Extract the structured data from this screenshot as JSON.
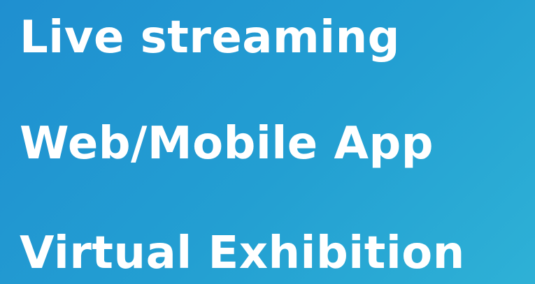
{
  "banner": {
    "background_colors": [
      "#1f8fd0",
      "#239fd2",
      "#2eb1d6"
    ],
    "text_color": "#ffffff",
    "lines": [
      {
        "text": "Live streaming"
      },
      {
        "text": "Web/Mobile App"
      },
      {
        "text": "Virtual Exhibition"
      }
    ]
  }
}
